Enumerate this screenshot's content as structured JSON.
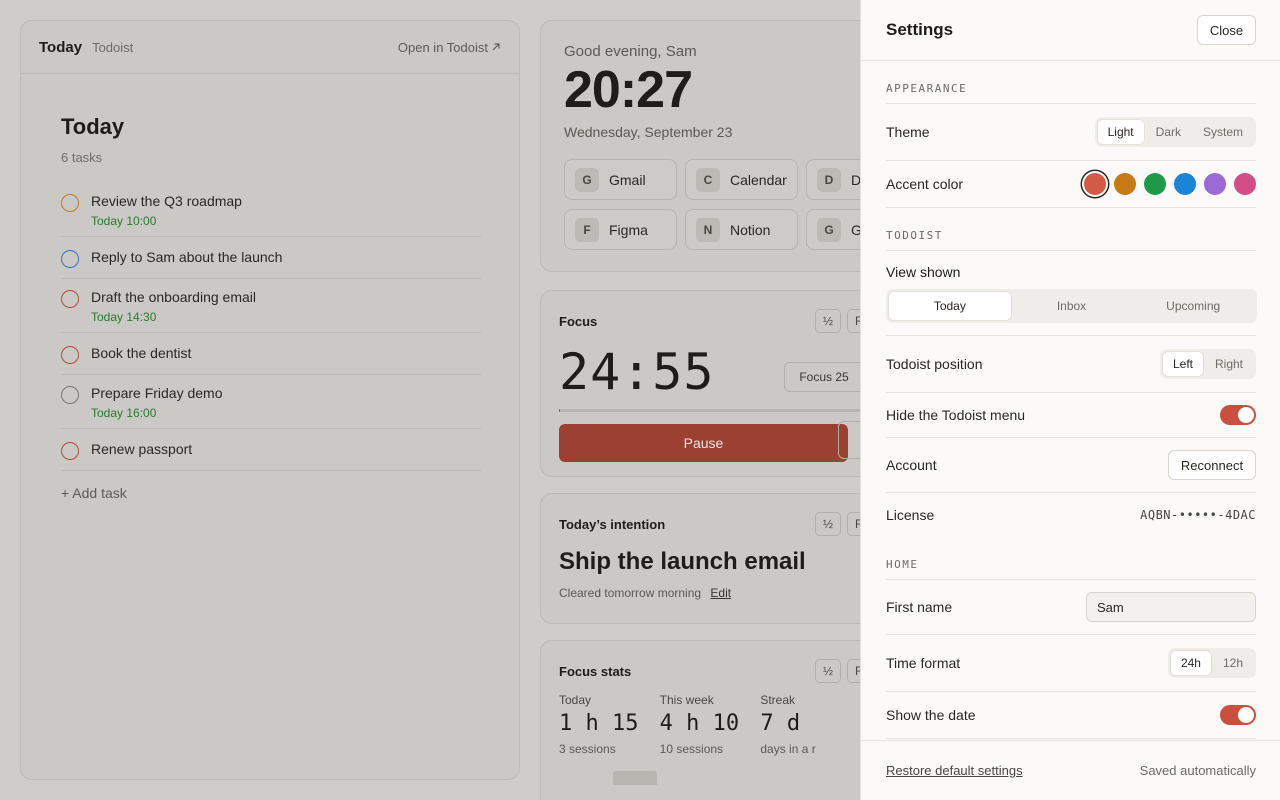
{
  "todoist": {
    "title": "Today",
    "app": "Todoist",
    "open_link": "Open in Todoist",
    "heading": "Today",
    "count": "6 tasks",
    "tasks": [
      {
        "title": "Review the Q3 roadmap",
        "due": "Today 10:00",
        "color": "#c77a1f"
      },
      {
        "title": "Reply to Sam about the launch",
        "due": "",
        "color": "#3a6fc9"
      },
      {
        "title": "Draft the onboarding email",
        "due": "Today 14:30",
        "color": "#b84a3a"
      },
      {
        "title": "Book the dentist",
        "due": "",
        "color": "#b84a3a"
      },
      {
        "title": "Prepare Friday demo",
        "due": "Today 16:00",
        "color": "#7a7672"
      },
      {
        "title": "Renew passport",
        "due": "",
        "color": "#b84a3a"
      }
    ],
    "add_task": "+ Add task"
  },
  "home": {
    "greeting": "Good evening, Sam",
    "time": "20:27",
    "date": "Wednesday, September 23",
    "links": [
      {
        "letter": "G",
        "name": "Gmail"
      },
      {
        "letter": "C",
        "name": "Calendar"
      },
      {
        "letter": "D",
        "name": "D"
      },
      {
        "letter": "F",
        "name": "Figma"
      },
      {
        "letter": "N",
        "name": "Notion"
      },
      {
        "letter": "G",
        "name": "G"
      }
    ]
  },
  "focus": {
    "title": "Focus",
    "half": "½",
    "reset": "R",
    "timer": "24:55",
    "preset": "Focus 25",
    "progress_fraction": 0.003,
    "pause": "Pause"
  },
  "intention": {
    "title": "Today’s intention",
    "half": "½",
    "reset": "R",
    "text": "Ship the launch email",
    "meta": "Cleared tomorrow morning",
    "edit": "Edit"
  },
  "stats": {
    "title": "Focus stats",
    "half": "½",
    "reset": "R",
    "items": [
      {
        "label": "Today",
        "value": "1 h 15",
        "sub": "3 sessions"
      },
      {
        "label": "This week",
        "value": "4 h 10",
        "sub": "10 sessions"
      },
      {
        "label": "Streak",
        "value": "7 d",
        "sub": "days in a r"
      }
    ]
  },
  "settings": {
    "title": "Settings",
    "close": "Close",
    "appearance": {
      "section": "APPEARANCE",
      "theme_label": "Theme",
      "theme_options": [
        "Light",
        "Dark",
        "System"
      ],
      "theme_selected": "Light",
      "accent_label": "Accent color",
      "accent_colors": [
        "#d35a45",
        "#c77a12",
        "#1f9a4a",
        "#1a84d6",
        "#9b6ad6",
        "#d24f86"
      ],
      "accent_selected": "#d35a45"
    },
    "todoist": {
      "section": "TODOIST",
      "view_label": "View shown",
      "view_options": [
        "Today",
        "Inbox",
        "Upcoming"
      ],
      "view_selected": "Today",
      "position_label": "Todoist position",
      "position_options": [
        "Left",
        "Right"
      ],
      "position_selected": "Left",
      "hide_menu_label": "Hide the Todoist menu",
      "hide_menu_on": true,
      "account_label": "Account",
      "reconnect": "Reconnect",
      "license_label": "License",
      "license_value": "AQBN-•••••-4DAC"
    },
    "home": {
      "section": "HOME",
      "first_name_label": "First name",
      "first_name_value": "Sam",
      "time_format_label": "Time format",
      "time_format_options": [
        "24h",
        "12h"
      ],
      "time_format_selected": "24h",
      "show_date_label": "Show the date",
      "show_date_on": true
    },
    "footer": {
      "restore": "Restore default settings",
      "saved": "Saved automatically"
    }
  }
}
